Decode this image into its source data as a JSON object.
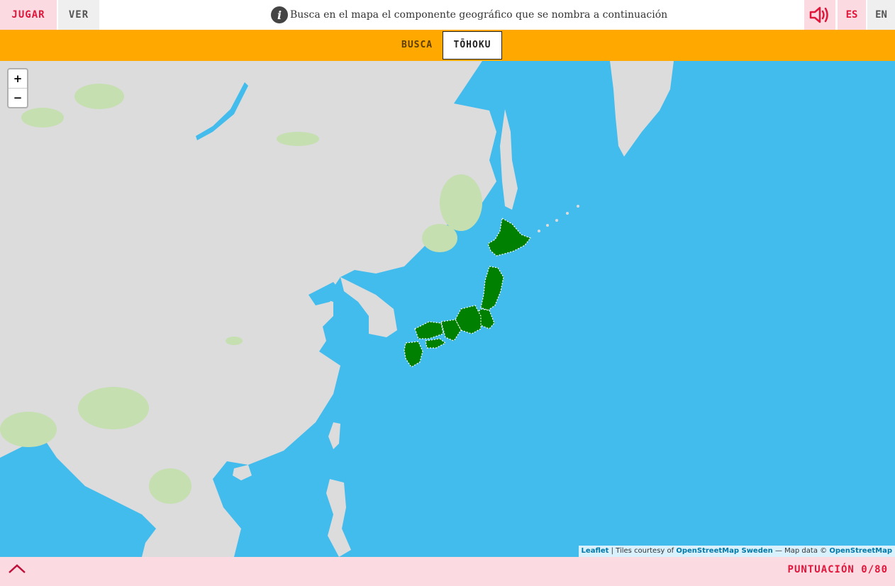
{
  "header": {
    "tab_play": "JUGAR",
    "tab_view": "VER",
    "instruction": "Busca en el mapa el componente geográfico que se nombra a continuación",
    "info_icon": "info-icon",
    "sound_icon": "speaker-icon",
    "lang_es": "ES",
    "lang_en": "EN"
  },
  "question": {
    "prompt": "BUSCA",
    "target": "TŌHOKU"
  },
  "map": {
    "zoom_in": "+",
    "zoom_out": "−",
    "highlight_color": "#008000",
    "water_color": "#42bbed",
    "land_color": "#dcdcdc",
    "attribution": {
      "leaflet": "Leaflet",
      "sep": " | Tiles courtesy of ",
      "osm_sweden": "OpenStreetMap Sweden",
      "mapdata": " — Map data © ",
      "osm": "OpenStreetMap"
    }
  },
  "footer": {
    "expand_icon": "chevron-up-icon",
    "score_label": "PUNTUACIÓN",
    "score_value": "0/80"
  }
}
